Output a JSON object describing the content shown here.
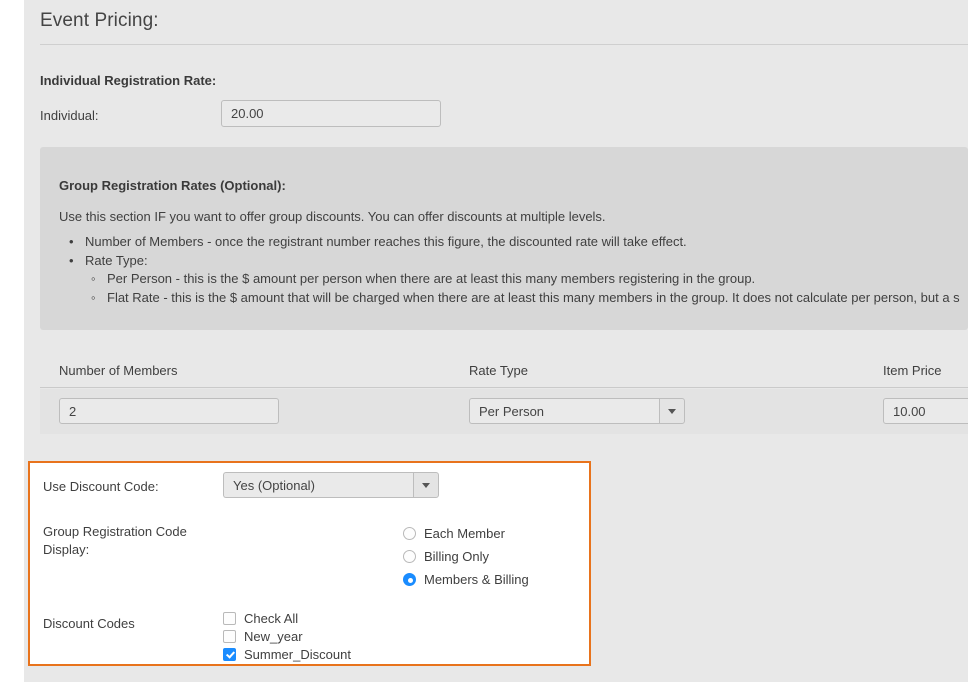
{
  "header": {
    "title": "Event Pricing:"
  },
  "individual": {
    "section_label": "Individual Registration Rate:",
    "field_label": "Individual:",
    "value": "20.00"
  },
  "info": {
    "title": "Group Registration Rates (Optional):",
    "intro": "Use this section IF you want to offer group discounts. You can offer discounts at multiple levels.",
    "bullets": [
      "Number of Members - once the registrant number reaches this figure, the discounted rate will take effect.",
      "Rate Type:"
    ],
    "subbullets": [
      "Per Person - this is the $ amount per person when there are at least this many members registering in the group.",
      "Flat Rate - this is the $ amount that will be charged when there are at least this many members in the group. It does not calculate per person, but a s"
    ]
  },
  "rates_table": {
    "columns": [
      "Number of Members",
      "Rate Type",
      "Item Price"
    ],
    "row": {
      "number_of_members": "2",
      "rate_type": "Per Person",
      "item_price": "10.00"
    }
  },
  "discount_panel": {
    "use_code_label": "Use Discount Code:",
    "use_code_value": "Yes (Optional)",
    "display_label": "Group Registration Code Display:",
    "display_options": [
      {
        "label": "Each Member",
        "selected": false
      },
      {
        "label": "Billing Only",
        "selected": false
      },
      {
        "label": "Members & Billing",
        "selected": true
      }
    ],
    "codes_label": "Discount Codes",
    "codes": [
      {
        "label": "Check All",
        "checked": false
      },
      {
        "label": "New_year",
        "checked": false
      },
      {
        "label": "Summer_Discount",
        "checked": true
      }
    ],
    "accent_color": "#e8731c",
    "selection_color": "#1a8cff"
  }
}
